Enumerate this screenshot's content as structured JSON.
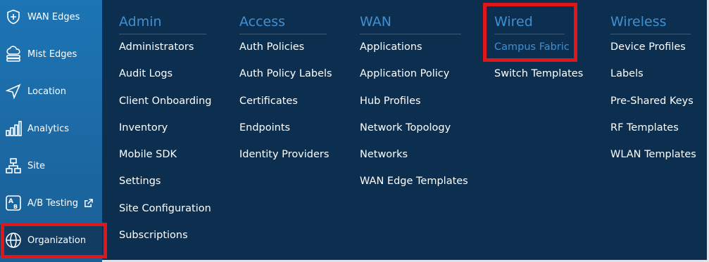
{
  "sidebar": {
    "items": [
      {
        "label": "WAN Edges",
        "icon": "plus-shield-icon"
      },
      {
        "label": "Mist Edges",
        "icon": "cloud-stack-icon"
      },
      {
        "label": "Location",
        "icon": "navigation-arrow-icon"
      },
      {
        "label": "Analytics",
        "icon": "bar-chart-icon"
      },
      {
        "label": "Site",
        "icon": "site-tree-icon"
      },
      {
        "label": "A/B Testing",
        "icon": "ab-testing-icon",
        "external_icon": "external-link-icon"
      },
      {
        "label": "Organization",
        "icon": "globe-icon",
        "active": true
      }
    ]
  },
  "menu": {
    "admin": {
      "title": "Admin",
      "items": [
        "Administrators",
        "Audit Logs",
        "Client Onboarding",
        "Inventory",
        "Mobile SDK",
        "Settings",
        "Site Configuration",
        "Subscriptions"
      ]
    },
    "access": {
      "title": "Access",
      "items": [
        "Auth Policies",
        "Auth Policy Labels",
        "Certificates",
        "Endpoints",
        "Identity Providers"
      ]
    },
    "wan": {
      "title": "WAN",
      "items": [
        "Applications",
        "Application Policy",
        "Hub Profiles",
        "Network Topology",
        "Networks",
        "WAN Edge Templates"
      ]
    },
    "wired": {
      "title": "Wired",
      "items": [
        "Campus Fabric",
        "Switch Templates"
      ],
      "selected": "Campus Fabric"
    },
    "wireless": {
      "title": "Wireless",
      "items": [
        "Device Profiles",
        "Labels",
        "Pre-Shared Keys",
        "RF Templates",
        "WLAN Templates"
      ]
    }
  },
  "colors": {
    "sidebar_bg": "#1d75b5",
    "sidebar_active": "#123c62",
    "menu_bg": "#0d2f4f",
    "heading": "#3f8fd1",
    "highlight": "#e0161b"
  }
}
